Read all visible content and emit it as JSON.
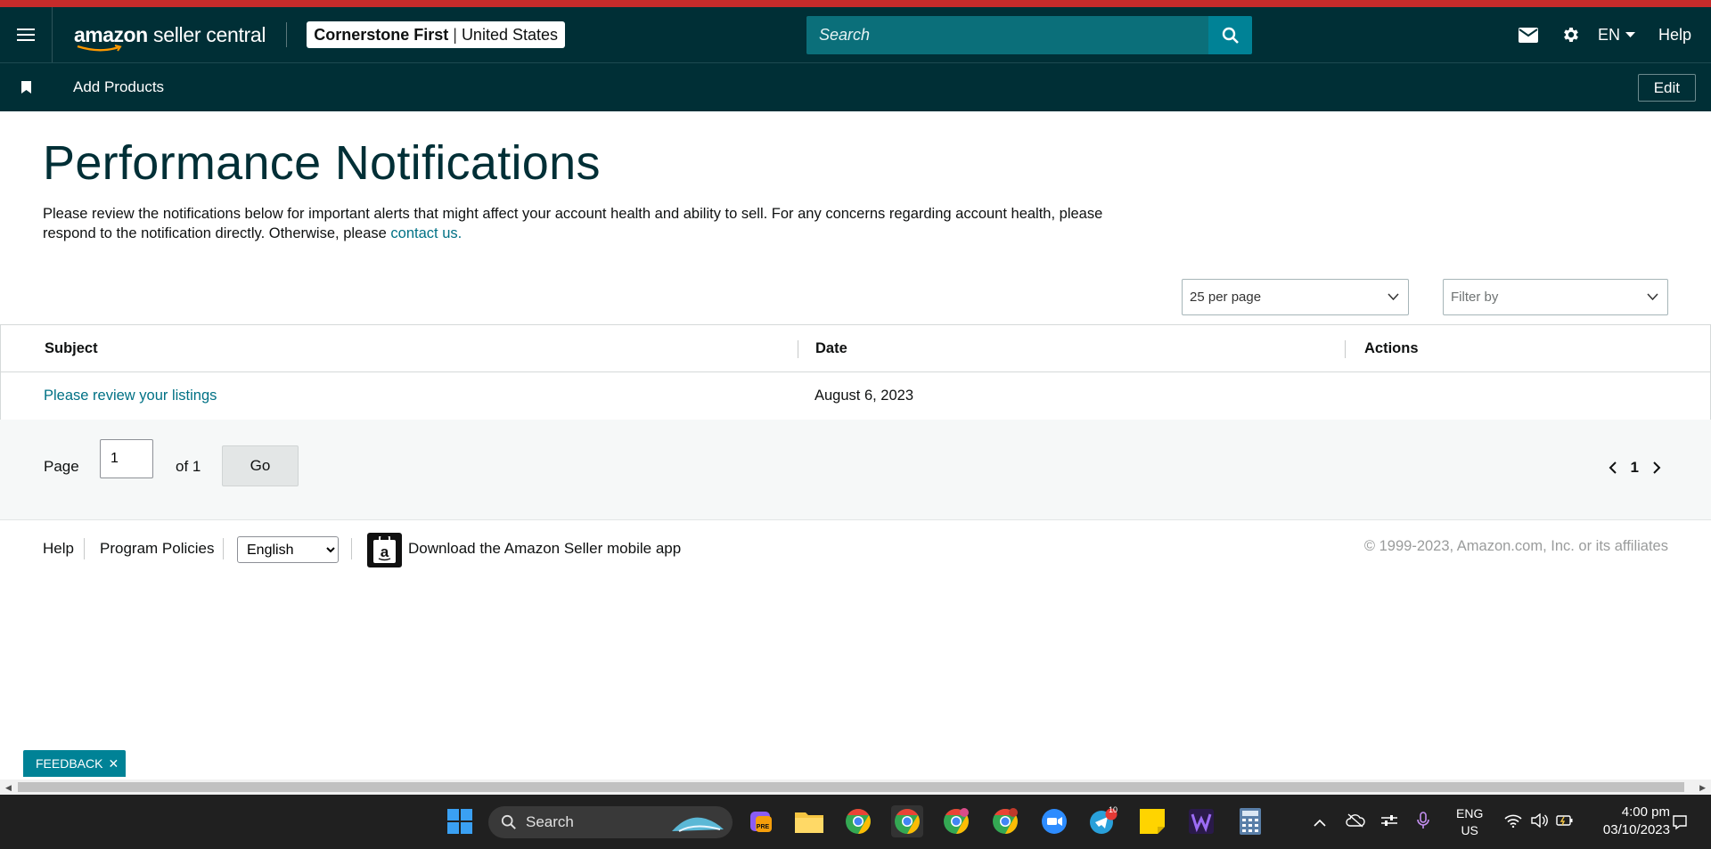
{
  "header": {
    "logo_brand": "amazon",
    "logo_product": "seller central",
    "account_name": "Cornerstone First",
    "account_separator": "|",
    "account_region": "United States",
    "search_placeholder": "Search",
    "language": "EN",
    "help": "Help"
  },
  "subnav": {
    "item": "Add Products",
    "edit": "Edit"
  },
  "main": {
    "title": "Performance Notifications",
    "description": "Please review the notifications below for important alerts that might affect your account health and ability to sell. For any concerns regarding account health, please respond to the notification directly. Otherwise, please",
    "contact_link": "contact us.",
    "per_page": "25 per page",
    "filter_placeholder": "Filter by"
  },
  "table": {
    "columns": [
      "Subject",
      "Date",
      "Actions"
    ],
    "rows": [
      {
        "subject": "Please review your listings",
        "date": "August 6, 2023",
        "actions": ""
      }
    ]
  },
  "pagination": {
    "page_label": "Page",
    "page_value": "1",
    "of_label": "of 1",
    "go": "Go",
    "current": "1"
  },
  "footer": {
    "help": "Help",
    "policies": "Program Policies",
    "language_option": "English",
    "app_text": "Download the Amazon Seller mobile app",
    "copyright": "© 1999-2023, Amazon.com, Inc. or its affiliates"
  },
  "feedback": {
    "label": "FEEDBACK",
    "close": "✕"
  },
  "taskbar": {
    "search": "Search",
    "lang_top": "ENG",
    "lang_bottom": "US",
    "time": "4:00 pm",
    "date": "03/10/2023",
    "telegram_badge": "10"
  },
  "colors": {
    "nav_bg": "#002f36",
    "accent": "#008296",
    "link": "#007185",
    "alert_bar": "#c62b2b"
  }
}
